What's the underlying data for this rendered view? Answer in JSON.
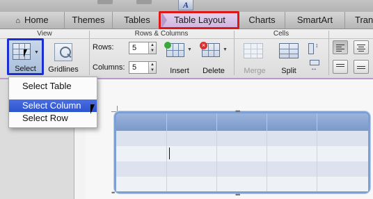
{
  "tabs": [
    {
      "label": "Home",
      "active": false
    },
    {
      "label": "Themes",
      "active": false
    },
    {
      "label": "Tables",
      "active": false
    },
    {
      "label": "Table Layout",
      "active": true
    },
    {
      "label": "Charts",
      "active": false
    },
    {
      "label": "SmartArt",
      "active": false
    },
    {
      "label": "Tran",
      "active": false
    }
  ],
  "ribbon": {
    "groups": {
      "view": "View",
      "rows_columns": "Rows & Columns",
      "cells": "Cells"
    },
    "select_label": "Select",
    "gridlines_label": "Gridlines",
    "rows_label": "Rows:",
    "rows_value": "5",
    "columns_label": "Columns:",
    "columns_value": "5",
    "insert_label": "Insert",
    "delete_label": "Delete",
    "merge_label": "Merge",
    "split_label": "Split"
  },
  "menu": {
    "items": [
      {
        "label": "Select Table",
        "highlighted": false
      },
      {
        "label": "Select Column",
        "highlighted": true
      },
      {
        "label": "Select Row",
        "highlighted": false
      }
    ]
  },
  "icons": [
    "home-icon",
    "text-style-icon",
    "table-select-icon",
    "gridlines-icon",
    "insert-icon",
    "delete-icon",
    "merge-icon",
    "split-icon",
    "distribute-rows-icon",
    "distribute-columns-icon",
    "align-left-icon",
    "align-center-icon",
    "mouse-pointer-icon"
  ],
  "colors": {
    "highlight_red": "#e01717",
    "select_box": "#1b2fd1",
    "menu_highlight": "#2d53cf",
    "table_accent": "#7da0d4",
    "active_tab": "#cfb3df"
  }
}
